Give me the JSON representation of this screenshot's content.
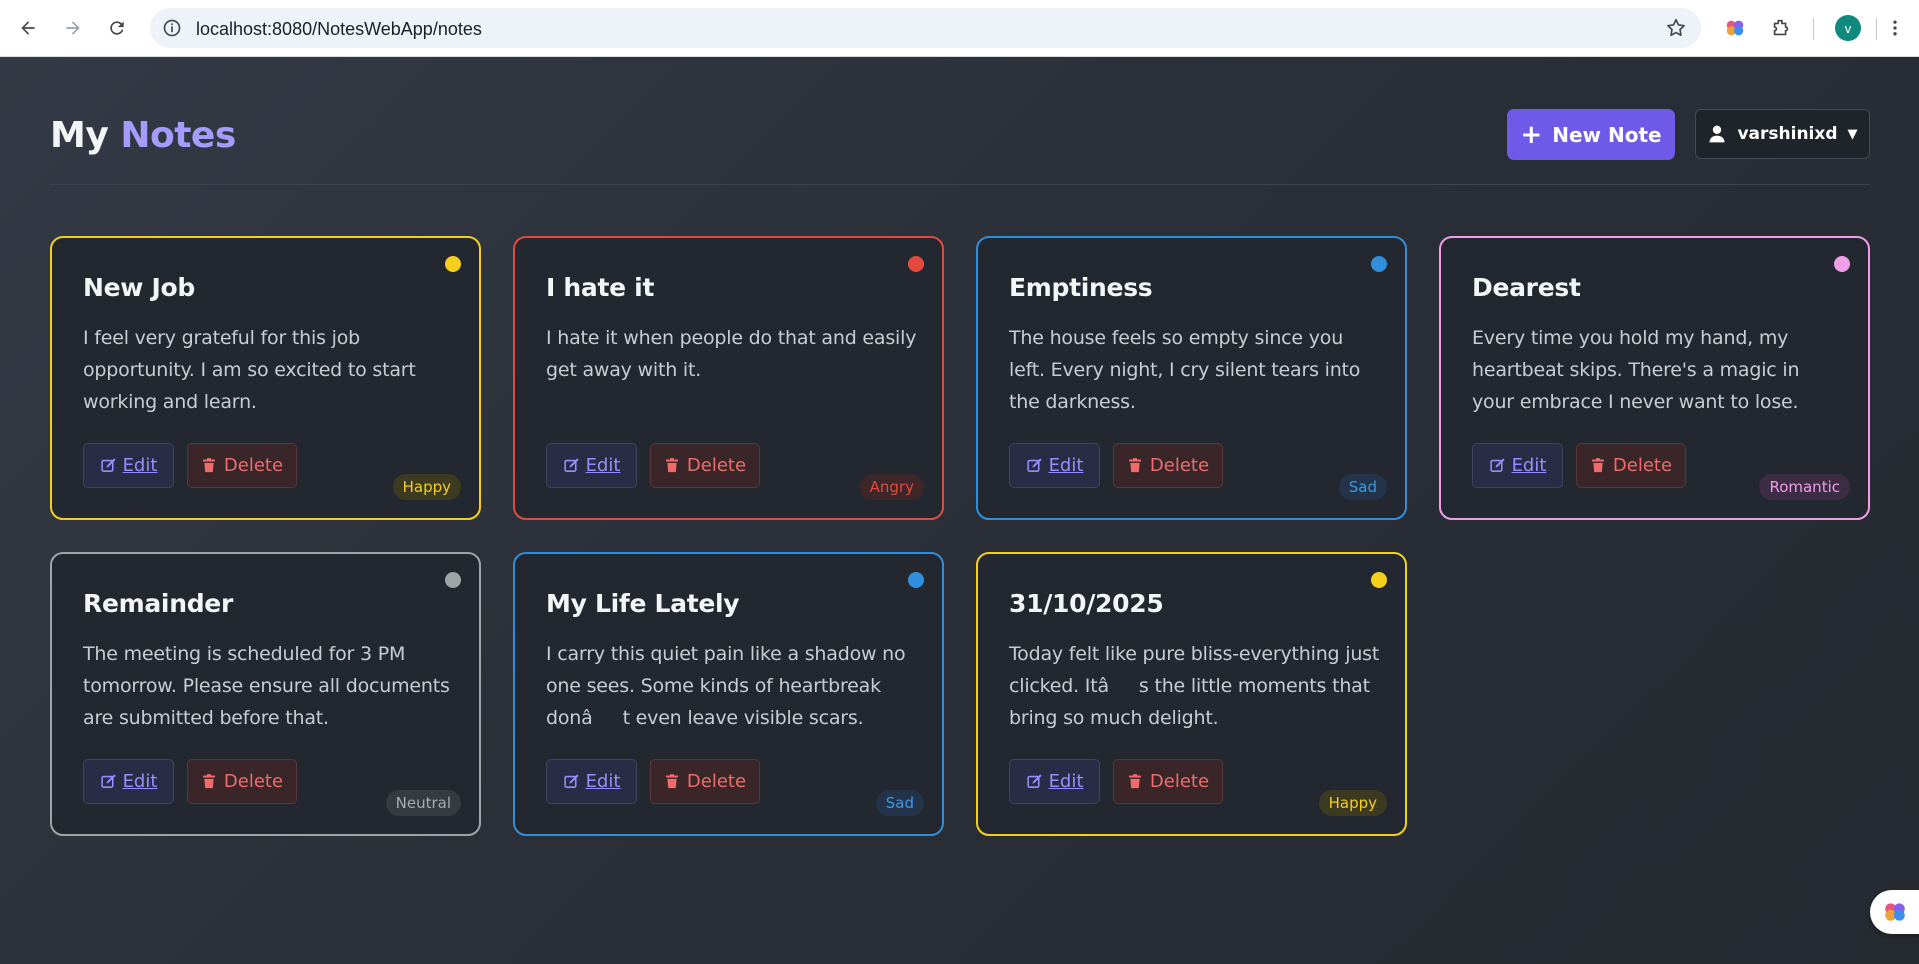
{
  "browser": {
    "url": "localhost:8080/NotesWebApp/notes",
    "profile_initial": "v"
  },
  "header": {
    "title_main": "My",
    "title_accent": "Notes",
    "new_note_label": "New Note",
    "username": "varshinixd"
  },
  "notes": [
    {
      "title": "New Job",
      "body": "I feel very grateful for this job opportunity. I am so excited to start working and learn.",
      "mood": "Happy",
      "color": "#f5cf1c",
      "mood_bg": "#3d3a22",
      "mood_fg": "#f5cf1c",
      "edit_label": "Edit",
      "delete_label": "Delete"
    },
    {
      "title": "I hate it",
      "body": "I hate it when people do that and easily get away with it.",
      "mood": "Angry",
      "color": "#e4493d",
      "mood_bg": "#3f2629",
      "mood_fg": "#e4493d",
      "edit_label": "Edit",
      "delete_label": "Delete"
    },
    {
      "title": "Emptiness",
      "body": "The house feels so empty since you left. Every night, I cry silent tears into the darkness.",
      "mood": "Sad",
      "color": "#2f8fdc",
      "mood_bg": "#23344a",
      "mood_fg": "#3b9ae6",
      "edit_label": "Edit",
      "delete_label": "Delete"
    },
    {
      "title": "Dearest",
      "body": "Every time you hold my hand, my heartbeat skips. There's a magic in your embrace I never want to lose.",
      "mood": "Romantic",
      "color": "#f09ee8",
      "mood_bg": "#3d2c44",
      "mood_fg": "#f09ee8",
      "edit_label": "Edit",
      "delete_label": "Delete"
    },
    {
      "title": "Remainder",
      "body": "The meeting is scheduled for 3 PM tomorrow. Please ensure all documents are submitted before that.",
      "mood": "Neutral",
      "color": "#9ea4a8",
      "mood_bg": "#363b42",
      "mood_fg": "#a7acb1",
      "edit_label": "Edit",
      "delete_label": "Delete"
    },
    {
      "title": "My Life Lately",
      "body": "I carry this quiet pain like a shadow no one sees. Some kinds of heartbreak donât even leave visible scars.",
      "mood": "Sad",
      "color": "#2f8fdc",
      "mood_bg": "#23344a",
      "mood_fg": "#3b9ae6",
      "edit_label": "Edit",
      "delete_label": "Delete"
    },
    {
      "title": "31/10/2025",
      "body": "Today felt like pure bliss-everything just clicked. Itâs the little moments that bring so much delight.",
      "mood": "Happy",
      "color": "#f5cf1c",
      "mood_bg": "#3d3a22",
      "mood_fg": "#f5cf1c",
      "edit_label": "Edit",
      "delete_label": "Delete"
    }
  ]
}
